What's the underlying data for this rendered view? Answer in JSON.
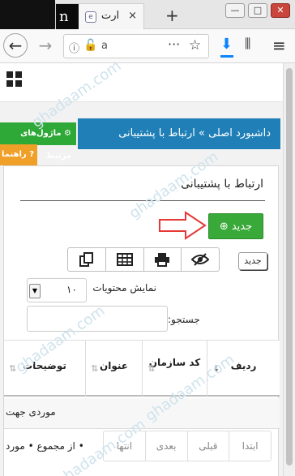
{
  "browser": {
    "tab_title": "ارت",
    "tab_close": "×",
    "new_tab": "+",
    "url_text": "a",
    "url_more": "···",
    "tab_dark_letter": "n",
    "favicon_letter": "e"
  },
  "nav": {
    "back": "←",
    "forward": "→",
    "download_icon": "download-icon",
    "library_icon": "library-icon",
    "menu_icon": "menu-icon"
  },
  "page": {
    "breadcrumb": "داشبورد اصلی » ارتباط با پشتیبانی",
    "modules_btn": "ماژول‌های مرتبط",
    "help_btn": "راهنما",
    "panel_title": "ارتباط با پشتیبانی",
    "new_button": "جدید",
    "small_new_btn": "جدید",
    "length_label": "نمایش محتویات",
    "length_value": "۱۰",
    "search_label": "جستجو:",
    "search_value": "",
    "table": {
      "headers": [
        "ردیف",
        "کد سازمان",
        "عنوان",
        "توضیحات"
      ],
      "row_text": "موردی جهت"
    },
    "info_text": "• از مجموع • مورد",
    "pager": [
      "ابتدا",
      "قبلی",
      "بعدی",
      "انتها"
    ]
  },
  "watermark": "ghadaam.com",
  "colors": {
    "breadcrumb_bg": "#1f7fb6",
    "green": "#39a939",
    "orange": "#f0a028",
    "arrow_red": "#e53935"
  }
}
